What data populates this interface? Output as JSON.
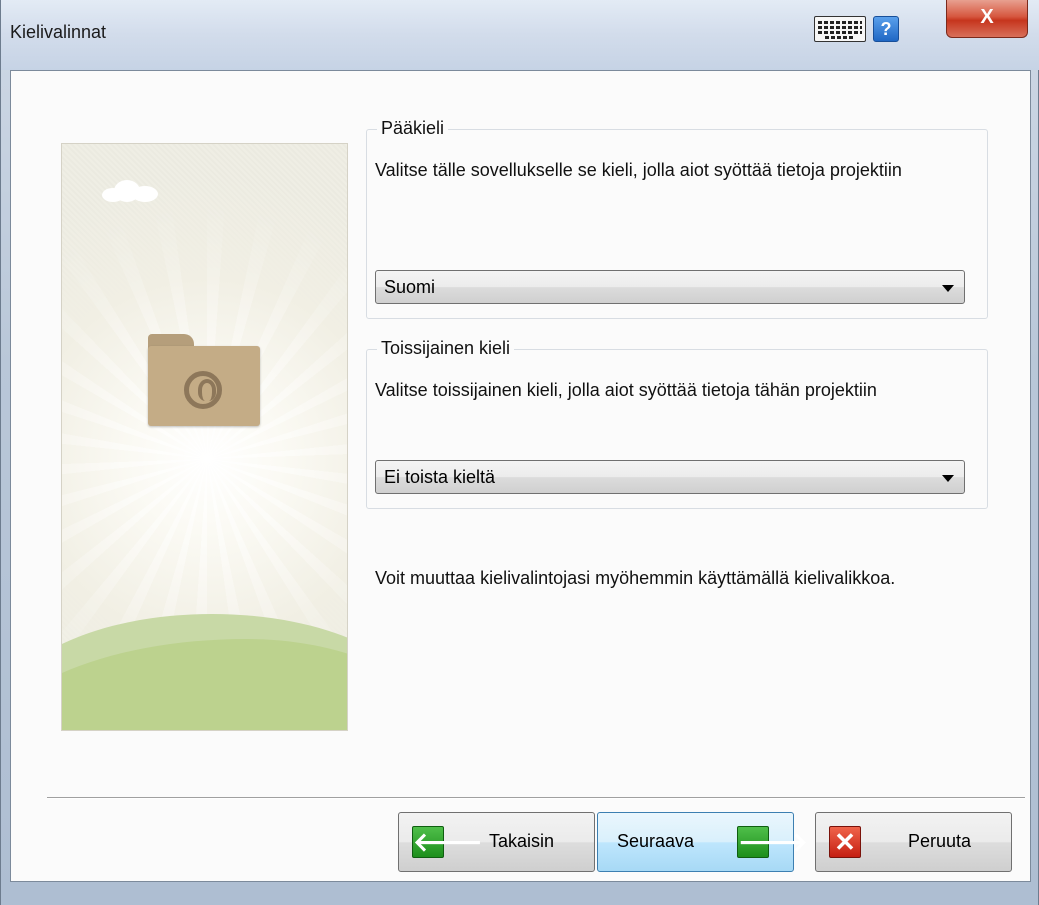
{
  "window": {
    "title": "Kielivalinnat",
    "close_glyph": "X",
    "help_glyph": "?",
    "icons": [
      "keyboard-icon",
      "help-icon",
      "close-icon"
    ]
  },
  "primary_language": {
    "legend": "Pääkieli",
    "description": "Valitse tälle sovellukselle se kieli, jolla aiot syöttää tietoja projektiin",
    "selected": "Suomi"
  },
  "secondary_language": {
    "legend": "Toissijainen kieli",
    "description": "Valitse toissijainen kieli, jolla aiot syöttää tietoja tähän projektiin",
    "selected": "Ei toista kieltä"
  },
  "note": "Voit muuttaa kielivalintojasi myöhemmin käyttämällä kielivalikkoa.",
  "buttons": {
    "back": "Takaisin",
    "next": "Seuraava",
    "cancel": "Peruuta",
    "back_glyph": "🡐",
    "next_glyph": "🡒",
    "cancel_glyph": "✕"
  },
  "colors": {
    "accent": "#3c7fb1",
    "green_icon": "#1d8f1c",
    "red_icon": "#c51f12"
  }
}
